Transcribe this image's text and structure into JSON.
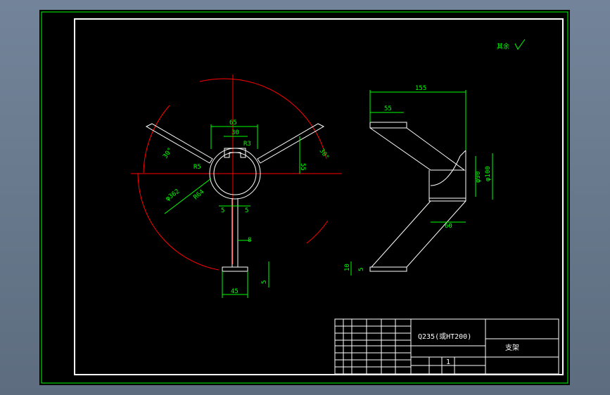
{
  "colors": {
    "background": "#000000",
    "window": "#6e7f91",
    "geometry": "#ffffff",
    "dimension": "#00ff00",
    "centerline": "#ff0000"
  },
  "dims_front": {
    "d65": "65",
    "d30": "30",
    "d5a": "5",
    "d5b": "5",
    "d8": "8",
    "d45": "45",
    "d5c": "5",
    "d55": "55",
    "ang_left": "30°",
    "ang_right": "30°",
    "r1": "R3",
    "r2": "R5",
    "dia": "φ362",
    "r_in": "R64"
  },
  "dims_side": {
    "d155": "155",
    "d55": "55",
    "d60": "60",
    "d10": "10",
    "d5": "5",
    "dia90": "φ90",
    "dia100": "φ100",
    "fit": "H7"
  },
  "title_block": {
    "material": "Q235(或HT200)",
    "part_name": "支架",
    "scale": "1"
  },
  "roughness_note": "其余"
}
